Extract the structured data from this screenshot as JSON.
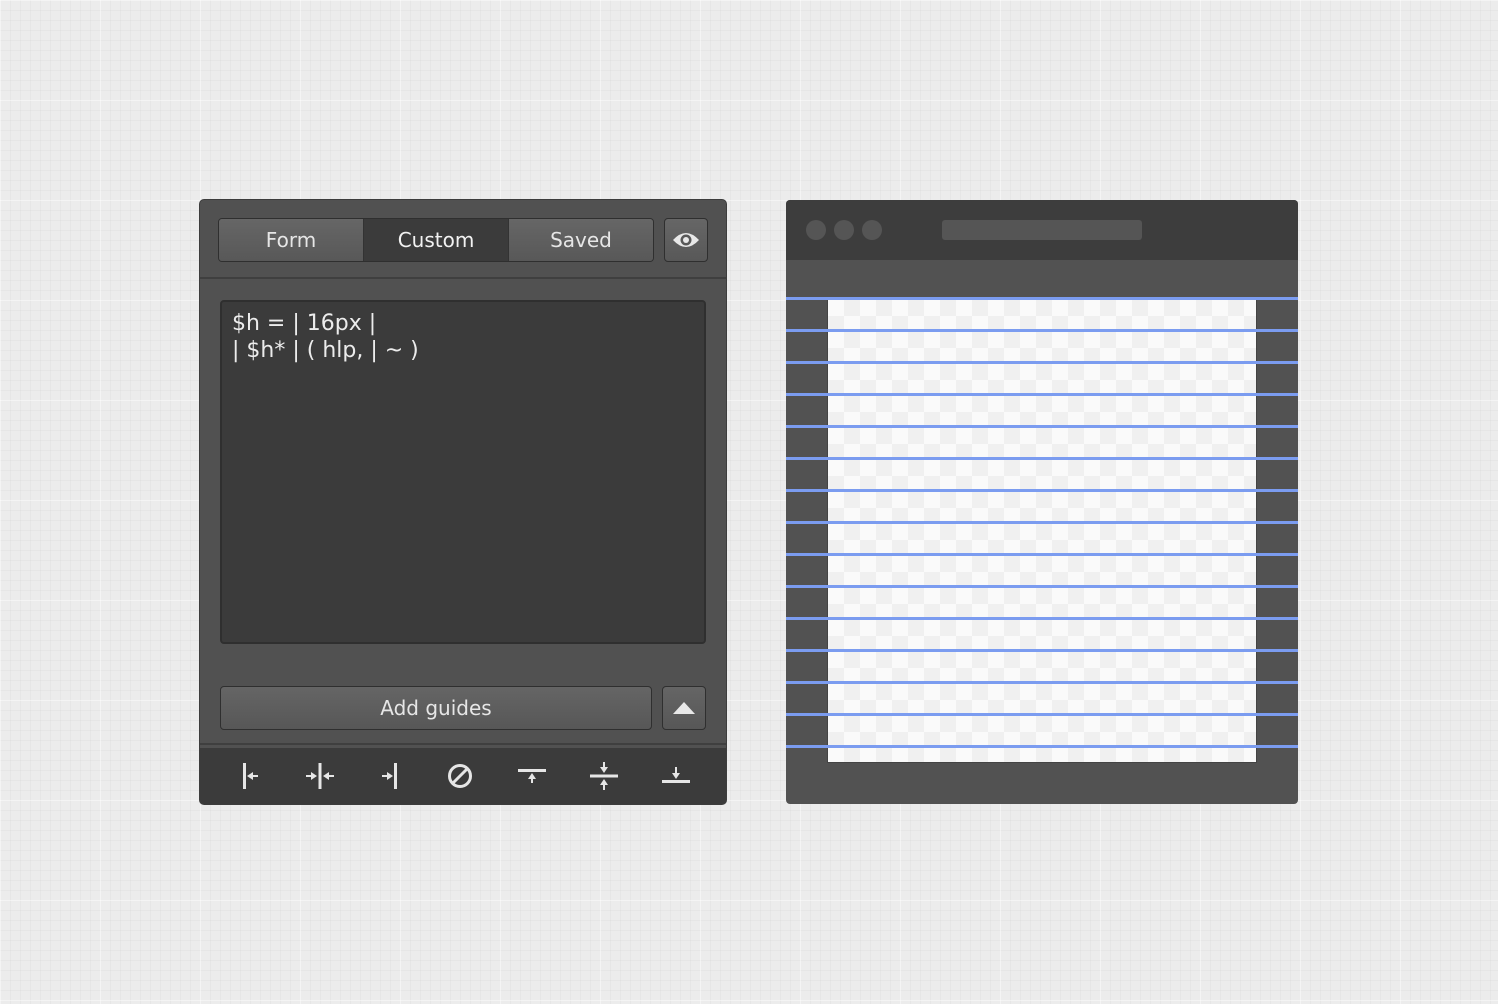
{
  "panel": {
    "tabs": [
      {
        "label": "Form",
        "active": false
      },
      {
        "label": "Custom",
        "active": true
      },
      {
        "label": "Saved",
        "active": false
      }
    ],
    "toggle_icon": "eye-icon",
    "editor_text": "$h = | 16px |\n| $h* | ( hlp, | ~ )",
    "add_guides_label": "Add guides",
    "expand_icon": "triangle-up-icon",
    "tools": [
      "align-left-guide-icon",
      "align-center-vertical-guide-icon",
      "align-right-guide-icon",
      "clear-guides-icon",
      "align-top-guide-icon",
      "align-middle-horizontal-guide-icon",
      "align-bottom-guide-icon"
    ]
  },
  "preview": {
    "guide_color": "#7b9cf0",
    "guide_count": 15
  },
  "colors": {
    "panel_bg": "#515151",
    "panel_dark": "#3b3b3b",
    "text": "#e6e6e6"
  }
}
